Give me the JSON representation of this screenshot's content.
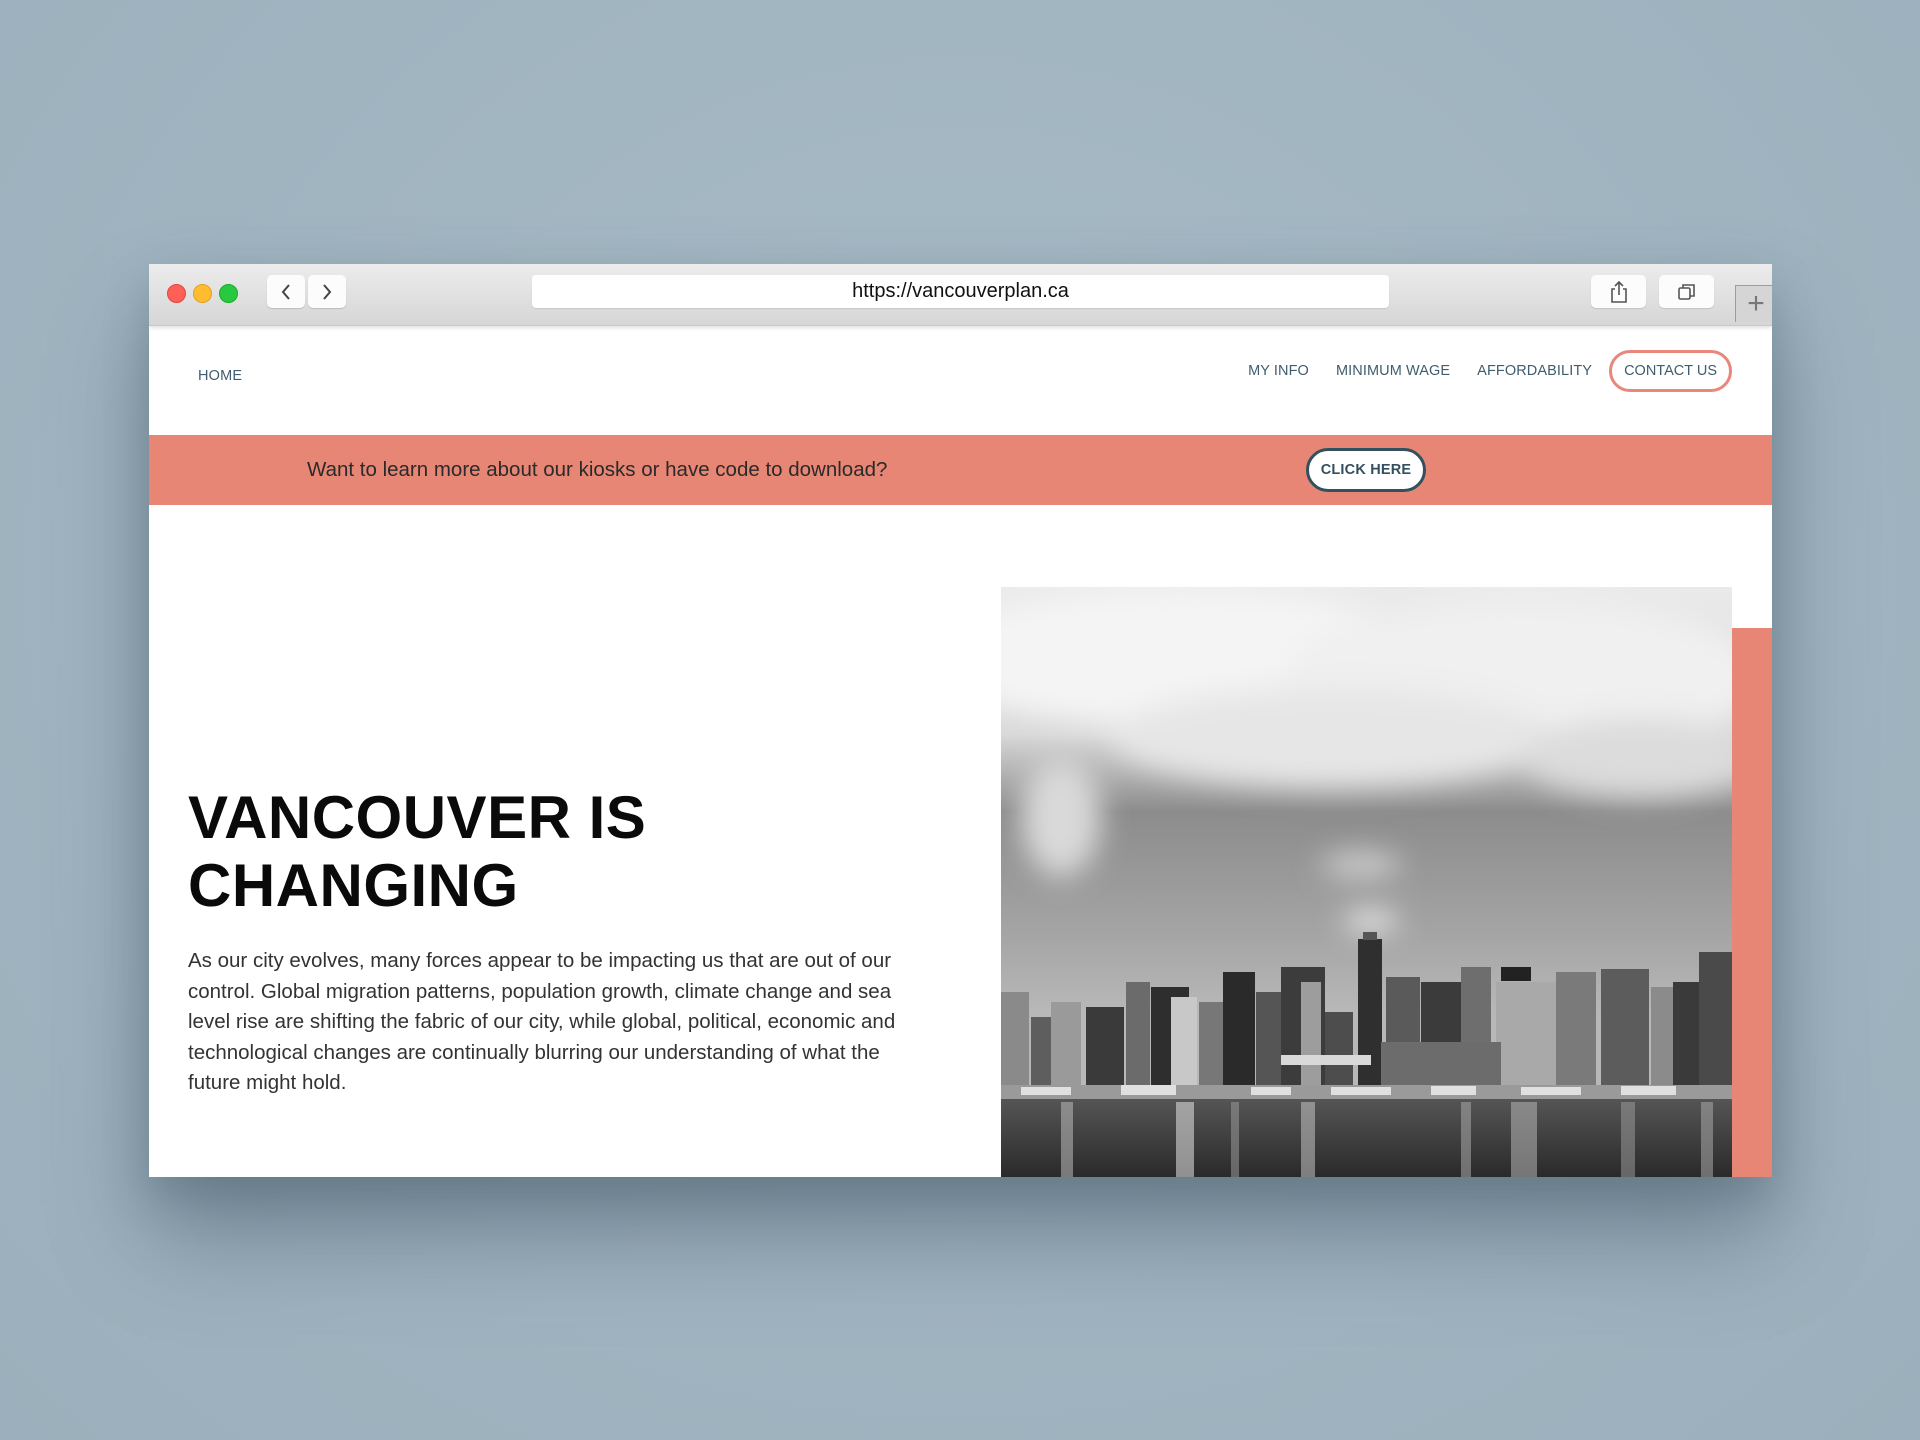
{
  "browser": {
    "url": "https://vancouverplan.ca",
    "icons": {
      "close": "close-window-icon",
      "minimize": "minimize-window-icon",
      "zoom": "zoom-window-icon",
      "back": "chevron-left-icon",
      "forward": "chevron-right-icon",
      "share": "share-icon",
      "tabs": "tabs-overview-icon",
      "new_tab": "plus-icon"
    },
    "new_tab_glyph": "+"
  },
  "nav": {
    "home": "HOME",
    "links": [
      "MY INFO",
      "MINIMUM WAGE",
      "AFFORDABILITY"
    ],
    "contact": "CONTACT US"
  },
  "banner": {
    "text": "Want to learn more about our kiosks or have code to download?",
    "button": "CLICK HERE"
  },
  "hero": {
    "headline_line1": "VANCOUVER IS",
    "headline_line2": "CHANGING",
    "body": "As our city evolves, many forces appear to be impacting us that are out of our control. Global migration patterns, population growth, climate change and sea level rise are shifting the fabric of our city, while global, political, economic and technological changes are continually blurring our understanding of what the future might hold.",
    "image_alt": "Black and white photo of the Vancouver skyline over a marina with cloudy sky"
  },
  "colors": {
    "accent": "#e88675",
    "nav_text": "#3f5d6e",
    "button_border": "#33505f",
    "background": "#a1b5c1"
  }
}
